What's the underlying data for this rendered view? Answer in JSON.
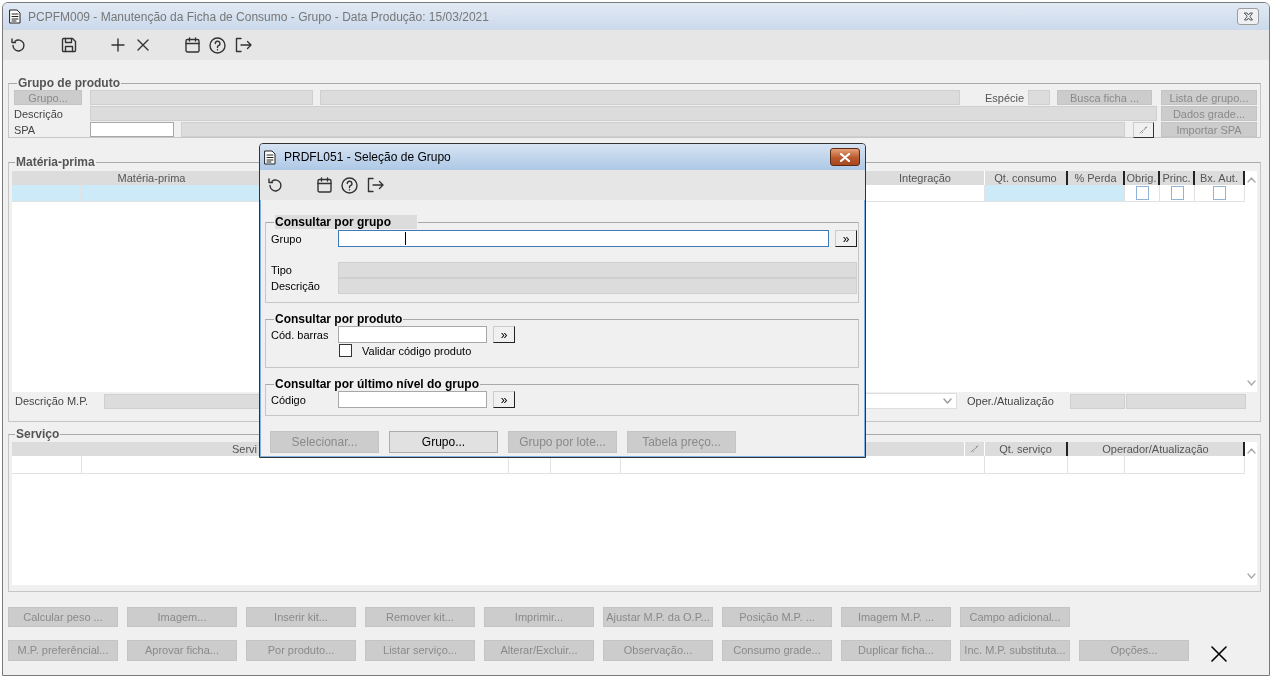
{
  "main_window": {
    "title": "PCPFM009 - Manutenção da Ficha de Consumo - Grupo - Data Produção: 15/03/2021"
  },
  "grupo_de_produto": {
    "legend": "Grupo de produto",
    "grupo_button": {
      "label": "Grupo...",
      "disabled": true
    },
    "especie_label": "Espécie",
    "busca_button": {
      "label": "Busca ficha ...",
      "disabled": true
    },
    "lista_button": {
      "label": "Lista de grupo...",
      "disabled": true
    },
    "descricao_label": "Descrição",
    "dados_button": {
      "label": "Dados grade...",
      "disabled": true
    },
    "spa_label": "SPA",
    "importar_button": {
      "label": "Importar SPA",
      "disabled": true
    }
  },
  "materia_prima": {
    "legend": "Matéria-prima",
    "columns": [
      {
        "label": "Matéria-prima"
      },
      {
        "label": "Integração"
      },
      {
        "label": "Qt. consumo"
      },
      {
        "label": "% Perda"
      },
      {
        "label": "Obrig."
      },
      {
        "label": "Princ."
      },
      {
        "label": "Bx. Aut."
      }
    ],
    "row_checks": [
      {
        "checked": false
      },
      {
        "checked": false
      },
      {
        "checked": false
      }
    ],
    "descricao_label": "Descrição M.P.",
    "oper_label": "Oper./Atualização"
  },
  "servico": {
    "legend": "Serviço",
    "columns": [
      {
        "label": "Servi"
      },
      {
        "label": "Qt. serviço"
      },
      {
        "label": "Operador/Atualização"
      }
    ]
  },
  "button_rows": [
    {
      "buttons": [
        {
          "label": "Calcular peso ...",
          "disabled": true
        },
        {
          "label": "Imagem...",
          "disabled": true
        },
        {
          "label": "Inserir kit...",
          "disabled": true
        },
        {
          "label": "Remover kit...",
          "disabled": true
        },
        {
          "label": "Imprimir...",
          "disabled": true
        },
        {
          "label": "Ajustar M.P. da O.P...",
          "disabled": true
        },
        {
          "label": "Posição M.P. ...",
          "disabled": true
        },
        {
          "label": "Imagem M.P. ...",
          "disabled": true
        },
        {
          "label": "Campo adicional...",
          "disabled": true
        }
      ]
    },
    {
      "buttons": [
        {
          "label": "M.P. preferêncial...",
          "disabled": true
        },
        {
          "label": "Aprovar ficha...",
          "disabled": true
        },
        {
          "label": "Por produto...",
          "disabled": true
        },
        {
          "label": "Listar serviço...",
          "disabled": true
        },
        {
          "label": "Alterar/Excluir...",
          "disabled": true
        },
        {
          "label": "Observação...",
          "disabled": true
        },
        {
          "label": "Consumo grade...",
          "disabled": true
        },
        {
          "label": "Duplicar ficha...",
          "disabled": true
        },
        {
          "label": "Inc. M.P. substituta...",
          "disabled": true
        },
        {
          "label": "Opções...",
          "disabled": true
        }
      ]
    }
  ],
  "dialog": {
    "title": "PRDFL051 - Seleção de Grupo",
    "por_grupo": {
      "legend": "Consultar por grupo",
      "grupo_label": "Grupo",
      "grupo_focused": true,
      "go_button": "»",
      "tipo_label": "Tipo",
      "descricao_label": "Descrição"
    },
    "por_produto": {
      "legend": "Consultar por produto",
      "cod_label": "Cód. barras",
      "go_button": "»",
      "validar": {
        "label": "Validar código produto",
        "checked": false
      }
    },
    "por_nivel": {
      "legend": "Consultar por último nível do grupo",
      "codigo_label": "Código",
      "go_button": "»"
    },
    "buttons": [
      {
        "label": "Selecionar...",
        "disabled": true
      },
      {
        "label": "Grupo...",
        "disabled": false
      },
      {
        "label": "Grupo por lote...",
        "disabled": true
      },
      {
        "label": "Tabela preço...",
        "disabled": true
      }
    ]
  }
}
